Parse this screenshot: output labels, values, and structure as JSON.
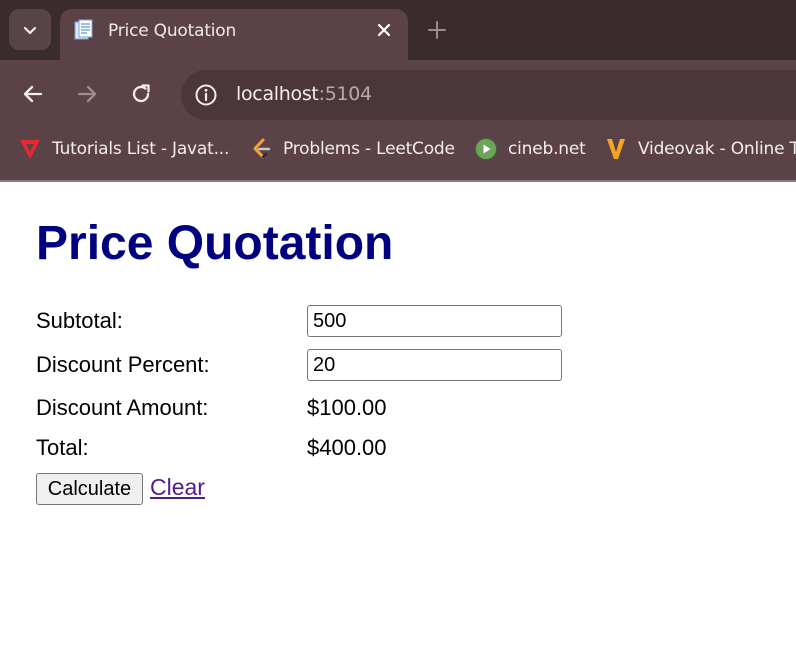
{
  "browser": {
    "tab": {
      "title": "Price Quotation"
    },
    "address": {
      "host": "localhost",
      "port": ":5104"
    },
    "bookmarks": [
      {
        "label": "Tutorials List - Javat...",
        "icon": "javatpoint-icon"
      },
      {
        "label": "Problems - LeetCode",
        "icon": "leetcode-icon"
      },
      {
        "label": "cineb.net",
        "icon": "cineb-icon"
      },
      {
        "label": "Videovak - Online T...",
        "icon": "videovak-icon"
      }
    ],
    "colors": {
      "tabstrip": "#3a2b2f",
      "toolbar": "#5b4247"
    }
  },
  "page": {
    "heading": "Price Quotation",
    "subtotal": {
      "label": "Subtotal:",
      "value": "500"
    },
    "discount_percent": {
      "label": "Discount Percent:",
      "value": "20"
    },
    "discount_amount": {
      "label": "Discount Amount:",
      "value": "$100.00"
    },
    "total": {
      "label": "Total:",
      "value": "$400.00"
    },
    "calculate_label": "Calculate",
    "clear_label": "Clear",
    "colors": {
      "heading": "#000080",
      "link": "#551a8b"
    }
  }
}
